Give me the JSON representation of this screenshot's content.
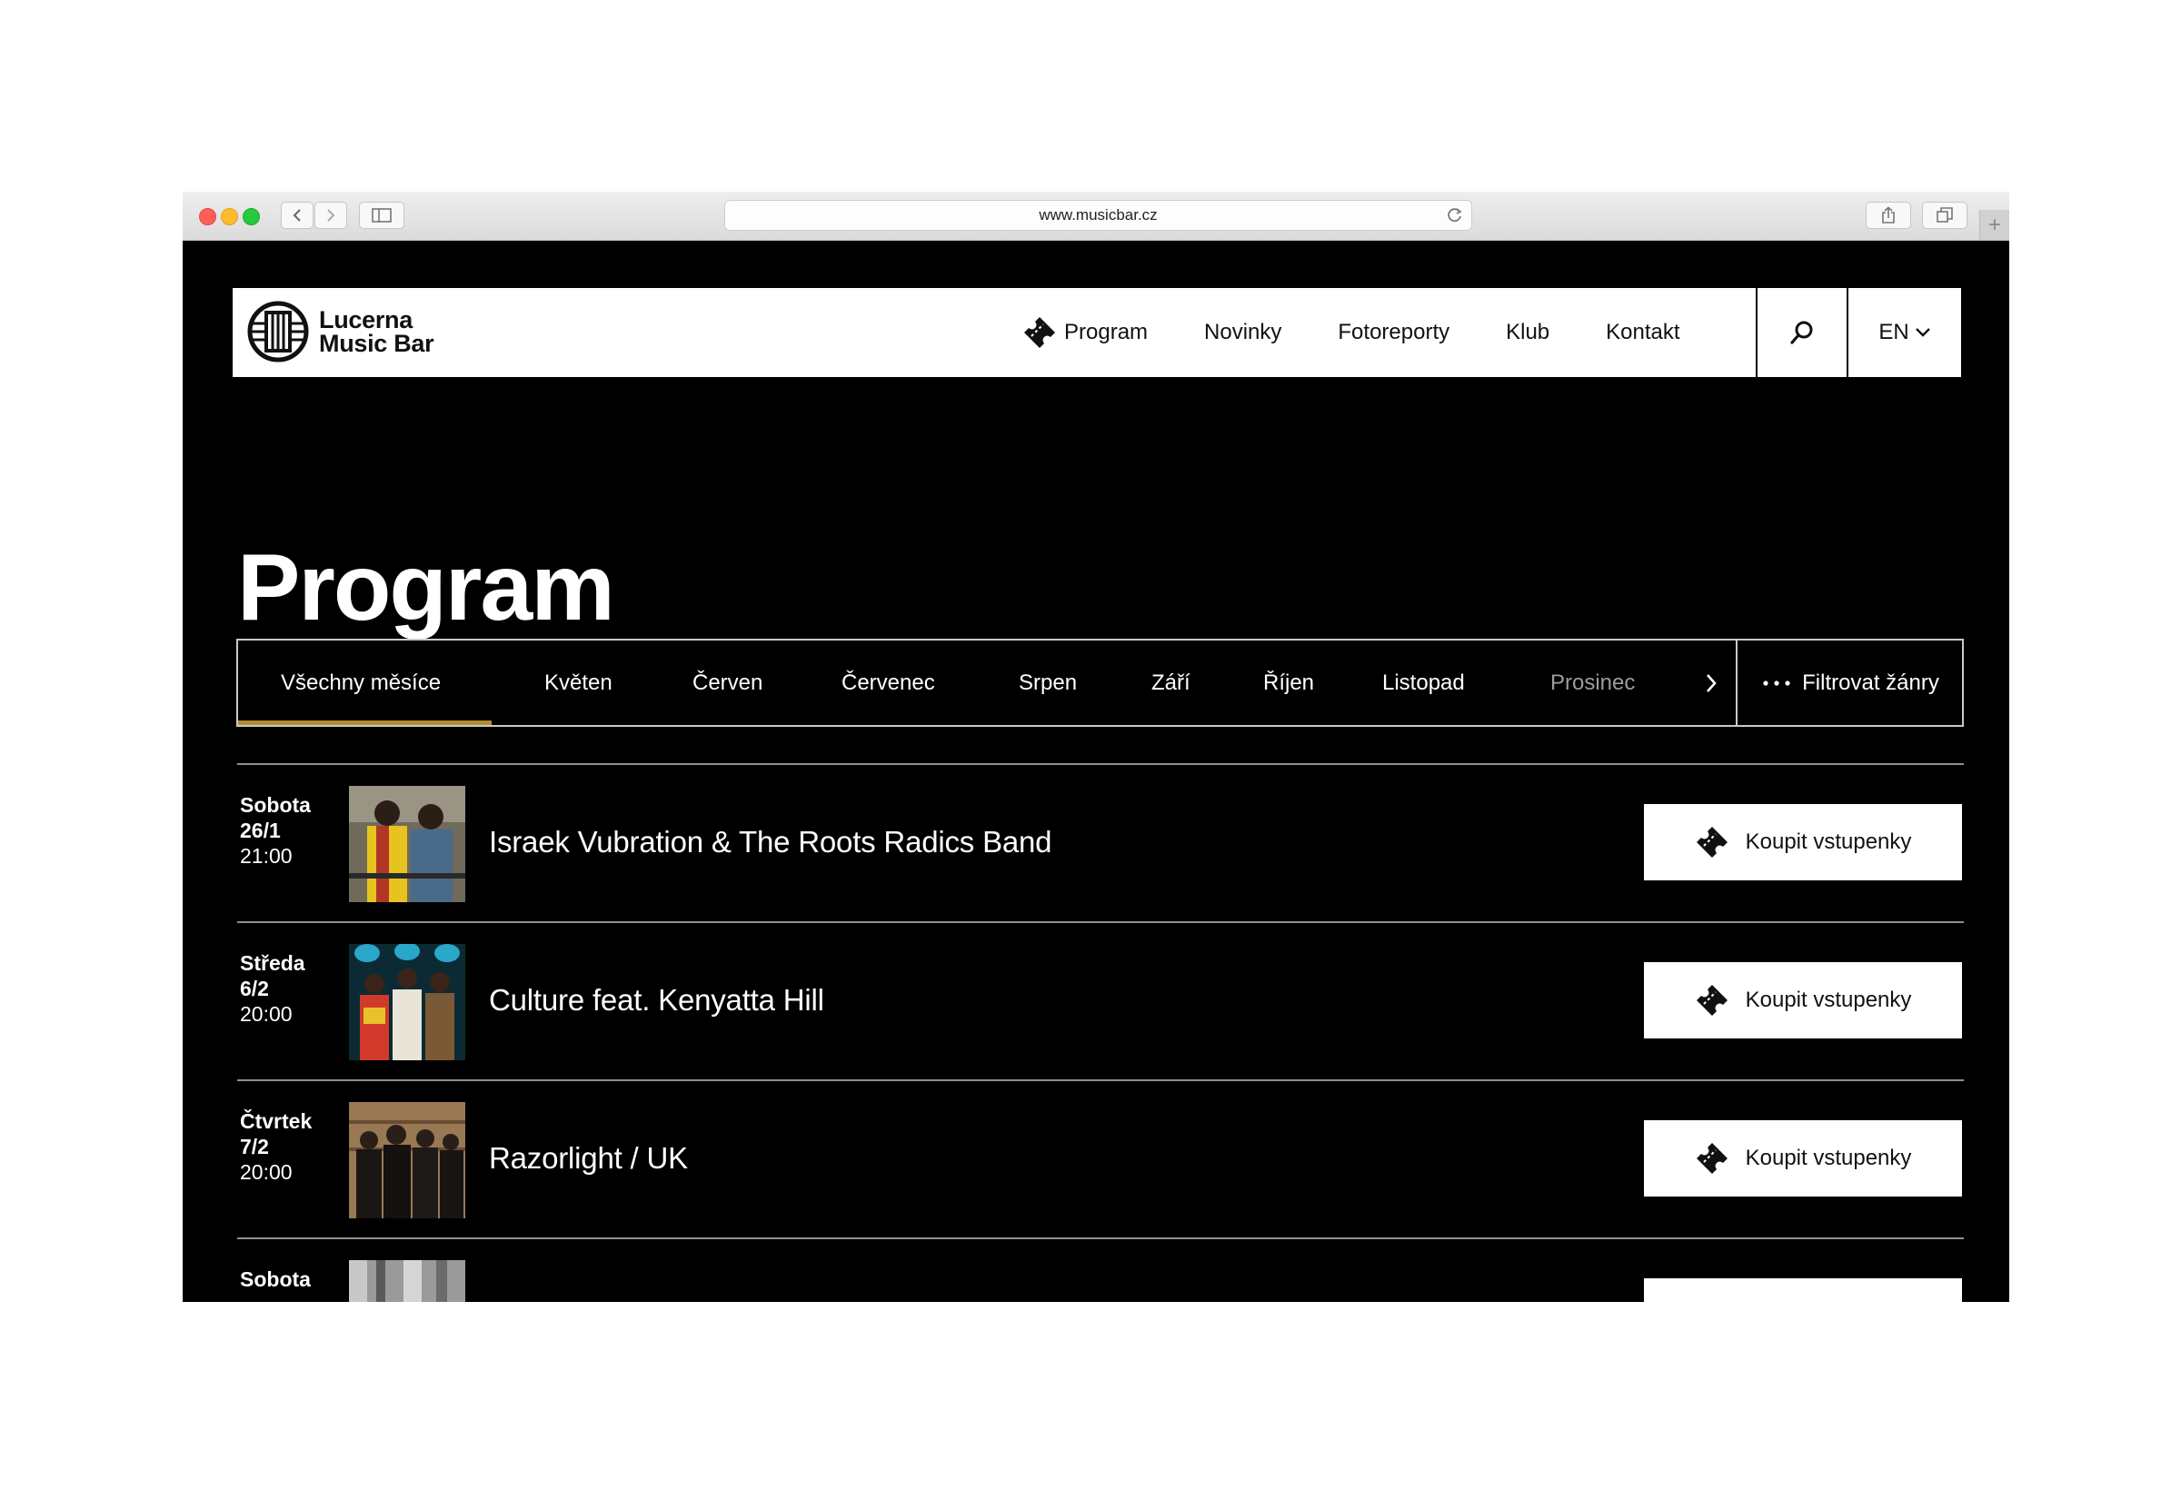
{
  "browser": {
    "url": "www.musicbar.cz"
  },
  "header": {
    "brand_line1": "Lucerna",
    "brand_line2": "Music Bar",
    "nav": [
      {
        "label": "Program",
        "icon": "ticket-icon"
      },
      {
        "label": "Novinky"
      },
      {
        "label": "Fotoreporty"
      },
      {
        "label": "Klub"
      },
      {
        "label": "Kontakt"
      }
    ],
    "language": "EN"
  },
  "page": {
    "title": "Program"
  },
  "months": {
    "items": [
      "Všechny měsíce",
      "Květen",
      "Červen",
      "Červenec",
      "Srpen",
      "Září",
      "Říjen",
      "Listopad",
      "Prosinec"
    ],
    "active": "Všechny měsíce",
    "filter_label": "Filtrovat žánry"
  },
  "events": [
    {
      "day": "Sobota",
      "date": "26/1",
      "time": "21:00",
      "title": "Israek Vubration  & The Roots Radics Band",
      "button": "Koupit vstupenky"
    },
    {
      "day": "Středa",
      "date": "6/2",
      "time": "20:00",
      "title": "Culture feat. Kenyatta Hill",
      "button": "Koupit vstupenky"
    },
    {
      "day": "Čtvrtek",
      "date": "7/2",
      "time": "20:00",
      "title": "Razorlight / UK",
      "button": "Koupit vstupenky"
    },
    {
      "day": "Sobota",
      "date": "",
      "time": "",
      "title": "",
      "button": ""
    }
  ],
  "colors": {
    "background": "#000000",
    "accent_underline": "#b38b2d",
    "header_bg": "#ffffff"
  }
}
